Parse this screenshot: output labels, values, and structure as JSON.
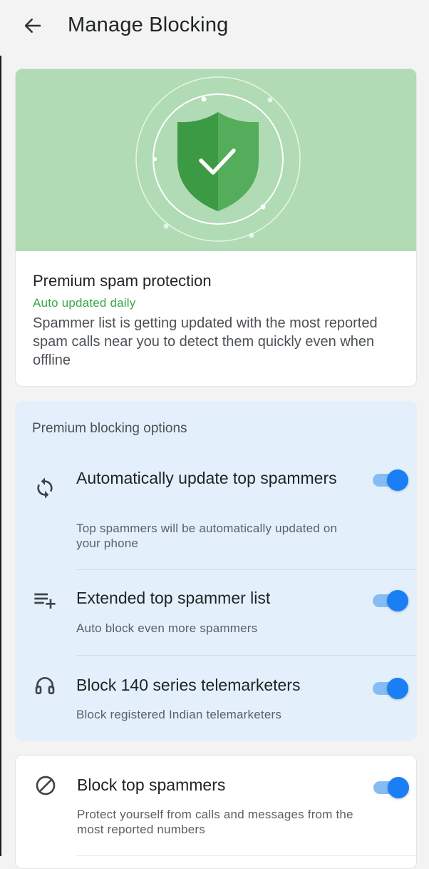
{
  "appbar": {
    "title": "Manage Blocking",
    "back_icon": "arrow-left-icon"
  },
  "hero": {
    "title": "Premium spam protection",
    "subtitle": "Auto updated daily",
    "description": "Spammer list is getting updated with the most reported spam calls near you to detect them quickly even when offline",
    "icon": "shield-check-icon",
    "colors": {
      "banner": "#b0dbb4",
      "shield": "#43a047",
      "subtitle": "#35a846"
    }
  },
  "premium": {
    "section_title": "Premium blocking options",
    "items": [
      {
        "icon": "sync-icon",
        "title": "Automatically update top spammers",
        "description": "Top spammers will be automatically updated on your phone",
        "enabled": true
      },
      {
        "icon": "playlist-add-icon",
        "title": "Extended top spammer list",
        "description": "Auto block even more spammers",
        "enabled": true
      },
      {
        "icon": "headset-icon",
        "title": "Block 140 series telemarketers",
        "description": "Block registered Indian telemarketers",
        "enabled": true
      }
    ]
  },
  "block": {
    "items": [
      {
        "icon": "block-icon",
        "title": "Block top spammers",
        "description": "Protect yourself from calls and messages from the most reported numbers",
        "enabled": true
      }
    ]
  },
  "colors": {
    "accent": "#1a7ff5",
    "accent_track": "#85bdf3",
    "premium_bg": "#e3f0fb"
  }
}
